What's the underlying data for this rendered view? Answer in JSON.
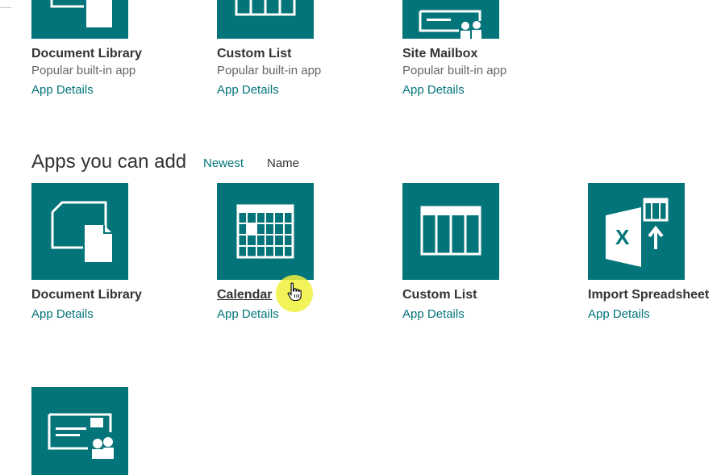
{
  "popular": [
    {
      "title": "Document Library",
      "subtitle": "Popular built-in app",
      "link": "App Details",
      "icon": "document-library-icon"
    },
    {
      "title": "Custom List",
      "subtitle": "Popular built-in app",
      "link": "App Details",
      "icon": "custom-list-icon"
    },
    {
      "title": "Site Mailbox",
      "subtitle": "Popular built-in app",
      "link": "App Details",
      "icon": "site-mailbox-icon"
    }
  ],
  "section": {
    "heading": "Apps you can add",
    "sort_newest": "Newest",
    "sort_name": "Name"
  },
  "apps": [
    {
      "title": "Document Library",
      "link": "App Details",
      "icon": "document-library-icon"
    },
    {
      "title": "Calendar",
      "link": "App Details",
      "icon": "calendar-icon"
    },
    {
      "title": "Custom List",
      "link": "App Details",
      "icon": "custom-list-icon"
    },
    {
      "title": "Import Spreadsheet",
      "link": "App Details",
      "icon": "excel-import-icon"
    },
    {
      "title": "",
      "link": "",
      "icon": "contacts-card-icon"
    }
  ],
  "colors": {
    "tile": "#037479",
    "link": "#037479",
    "cursor_highlight": "#f0f03c"
  }
}
